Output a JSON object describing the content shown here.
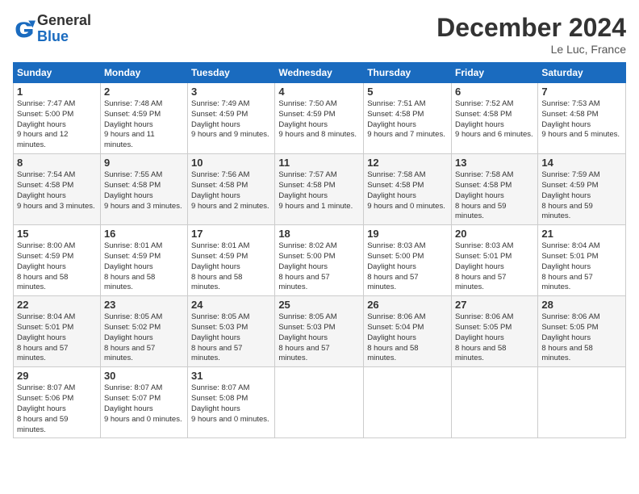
{
  "logo": {
    "general": "General",
    "blue": "Blue"
  },
  "title": "December 2024",
  "location": "Le Luc, France",
  "headers": [
    "Sunday",
    "Monday",
    "Tuesday",
    "Wednesday",
    "Thursday",
    "Friday",
    "Saturday"
  ],
  "weeks": [
    [
      {
        "day": "1",
        "sunrise": "7:47 AM",
        "sunset": "5:00 PM",
        "daylight": "9 hours and 12 minutes."
      },
      {
        "day": "2",
        "sunrise": "7:48 AM",
        "sunset": "4:59 PM",
        "daylight": "9 hours and 11 minutes."
      },
      {
        "day": "3",
        "sunrise": "7:49 AM",
        "sunset": "4:59 PM",
        "daylight": "9 hours and 9 minutes."
      },
      {
        "day": "4",
        "sunrise": "7:50 AM",
        "sunset": "4:59 PM",
        "daylight": "9 hours and 8 minutes."
      },
      {
        "day": "5",
        "sunrise": "7:51 AM",
        "sunset": "4:58 PM",
        "daylight": "9 hours and 7 minutes."
      },
      {
        "day": "6",
        "sunrise": "7:52 AM",
        "sunset": "4:58 PM",
        "daylight": "9 hours and 6 minutes."
      },
      {
        "day": "7",
        "sunrise": "7:53 AM",
        "sunset": "4:58 PM",
        "daylight": "9 hours and 5 minutes."
      }
    ],
    [
      {
        "day": "8",
        "sunrise": "7:54 AM",
        "sunset": "4:58 PM",
        "daylight": "9 hours and 3 minutes."
      },
      {
        "day": "9",
        "sunrise": "7:55 AM",
        "sunset": "4:58 PM",
        "daylight": "9 hours and 3 minutes."
      },
      {
        "day": "10",
        "sunrise": "7:56 AM",
        "sunset": "4:58 PM",
        "daylight": "9 hours and 2 minutes."
      },
      {
        "day": "11",
        "sunrise": "7:57 AM",
        "sunset": "4:58 PM",
        "daylight": "9 hours and 1 minute."
      },
      {
        "day": "12",
        "sunrise": "7:58 AM",
        "sunset": "4:58 PM",
        "daylight": "9 hours and 0 minutes."
      },
      {
        "day": "13",
        "sunrise": "7:58 AM",
        "sunset": "4:58 PM",
        "daylight": "8 hours and 59 minutes."
      },
      {
        "day": "14",
        "sunrise": "7:59 AM",
        "sunset": "4:59 PM",
        "daylight": "8 hours and 59 minutes."
      }
    ],
    [
      {
        "day": "15",
        "sunrise": "8:00 AM",
        "sunset": "4:59 PM",
        "daylight": "8 hours and 58 minutes."
      },
      {
        "day": "16",
        "sunrise": "8:01 AM",
        "sunset": "4:59 PM",
        "daylight": "8 hours and 58 minutes."
      },
      {
        "day": "17",
        "sunrise": "8:01 AM",
        "sunset": "4:59 PM",
        "daylight": "8 hours and 58 minutes."
      },
      {
        "day": "18",
        "sunrise": "8:02 AM",
        "sunset": "5:00 PM",
        "daylight": "8 hours and 57 minutes."
      },
      {
        "day": "19",
        "sunrise": "8:03 AM",
        "sunset": "5:00 PM",
        "daylight": "8 hours and 57 minutes."
      },
      {
        "day": "20",
        "sunrise": "8:03 AM",
        "sunset": "5:01 PM",
        "daylight": "8 hours and 57 minutes."
      },
      {
        "day": "21",
        "sunrise": "8:04 AM",
        "sunset": "5:01 PM",
        "daylight": "8 hours and 57 minutes."
      }
    ],
    [
      {
        "day": "22",
        "sunrise": "8:04 AM",
        "sunset": "5:01 PM",
        "daylight": "8 hours and 57 minutes."
      },
      {
        "day": "23",
        "sunrise": "8:05 AM",
        "sunset": "5:02 PM",
        "daylight": "8 hours and 57 minutes."
      },
      {
        "day": "24",
        "sunrise": "8:05 AM",
        "sunset": "5:03 PM",
        "daylight": "8 hours and 57 minutes."
      },
      {
        "day": "25",
        "sunrise": "8:05 AM",
        "sunset": "5:03 PM",
        "daylight": "8 hours and 57 minutes."
      },
      {
        "day": "26",
        "sunrise": "8:06 AM",
        "sunset": "5:04 PM",
        "daylight": "8 hours and 58 minutes."
      },
      {
        "day": "27",
        "sunrise": "8:06 AM",
        "sunset": "5:05 PM",
        "daylight": "8 hours and 58 minutes."
      },
      {
        "day": "28",
        "sunrise": "8:06 AM",
        "sunset": "5:05 PM",
        "daylight": "8 hours and 58 minutes."
      }
    ],
    [
      {
        "day": "29",
        "sunrise": "8:07 AM",
        "sunset": "5:06 PM",
        "daylight": "8 hours and 59 minutes."
      },
      {
        "day": "30",
        "sunrise": "8:07 AM",
        "sunset": "5:07 PM",
        "daylight": "9 hours and 0 minutes."
      },
      {
        "day": "31",
        "sunrise": "8:07 AM",
        "sunset": "5:08 PM",
        "daylight": "9 hours and 0 minutes."
      },
      null,
      null,
      null,
      null
    ]
  ],
  "labels": {
    "sunrise": "Sunrise:",
    "sunset": "Sunset:",
    "daylight": "Daylight hours"
  }
}
